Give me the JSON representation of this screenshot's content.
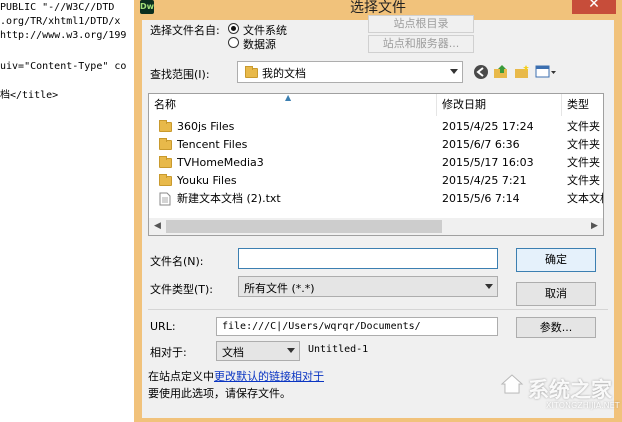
{
  "background_code": [
    " PUBLIC \"-//W3C//DTD",
    ".org/TR/xhtml1/DTD/x",
    "http://www.w3.org/199",
    "",
    "uiv=\"Content-Type\" co",
    "",
    "档</title>"
  ],
  "dialog": {
    "title": "选择文件",
    "app_icon": "Dw",
    "close_glyph": "✕",
    "select_from_label": "选择文件名自:",
    "radio_filesystem": "文件系统",
    "radio_datasource": "数据源",
    "site_root_button": "站点根目录",
    "site_server_button": "站点和服务器...",
    "look_in_label": "查找范围(I):",
    "look_in_value": "我的文档",
    "columns": {
      "name": "名称",
      "modified": "修改日期",
      "type": "类型"
    },
    "files": [
      {
        "name": "360js Files",
        "modified": "2015/4/25 17:24",
        "type": "文件夹",
        "icon": "folder-icon"
      },
      {
        "name": "Tencent Files",
        "modified": "2015/6/7 6:36",
        "type": "文件夹",
        "icon": "folder-icon"
      },
      {
        "name": "TVHomeMedia3",
        "modified": "2015/5/17 16:03",
        "type": "文件夹",
        "icon": "folder-icon"
      },
      {
        "name": "Youku Files",
        "modified": "2015/4/25 7:21",
        "type": "文件夹",
        "icon": "folder-icon"
      },
      {
        "name": "新建文本文档 (2).txt",
        "modified": "2015/5/6 7:14",
        "type": "文本文档",
        "icon": "text-file-icon"
      }
    ],
    "filename_label": "文件名(N):",
    "filename_value": "",
    "ok_button": "确定",
    "filetype_label": "文件类型(T):",
    "filetype_value": "所有文件 (*.*)",
    "cancel_button": "取消",
    "url_label": "URL:",
    "url_value": "file:///C|/Users/wqrqr/Documents/",
    "params_button": "参数...",
    "relative_label": "相对于:",
    "relative_value": "文档",
    "relative_doc": "Untitled-1",
    "site_def_prefix": "在站点定义中",
    "site_def_link": "更改默认的链接相对于",
    "save_notice": "要使用此选项，请保存文件。"
  },
  "watermark": {
    "text": "系统之家",
    "url": "XITONGZHIJIA.NET"
  },
  "colors": {
    "title_bar": "#f1c27b",
    "close": "#c74d3a",
    "link": "#0a35c2",
    "focus_border": "#3c7fb1"
  }
}
